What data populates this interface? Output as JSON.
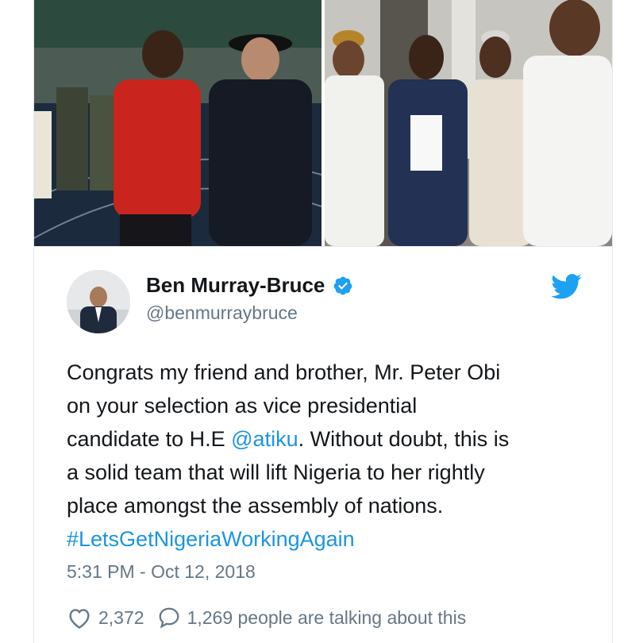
{
  "tweet": {
    "author": {
      "name": "Ben Murray-Bruce",
      "handle": "@benmurraybruce",
      "verified": true
    },
    "text_lines": [
      {
        "parts": [
          {
            "text": "Congrats my friend and brother, Mr. Peter Obi",
            "type": "plain"
          }
        ]
      },
      {
        "parts": [
          {
            "text": "on your selection as vice presidential",
            "type": "plain"
          }
        ]
      },
      {
        "parts": [
          {
            "text": "candidate to H.E ",
            "type": "plain"
          },
          {
            "text": "@atiku",
            "type": "mention"
          },
          {
            "text": ". Without doubt, this is",
            "type": "plain"
          }
        ]
      },
      {
        "parts": [
          {
            "text": "a solid team that will lift Nigeria to her rightly",
            "type": "plain"
          }
        ]
      },
      {
        "parts": [
          {
            "text": "place amongst the assembly of nations.",
            "type": "plain"
          }
        ]
      },
      {
        "parts": [
          {
            "text": "#LetsGetNigeriaWorkingAgain",
            "type": "hashtag"
          }
        ]
      }
    ],
    "timestamp": "5:31 PM - Oct 12, 2018",
    "likes": "2,372",
    "talking": "1,269 people are talking about this"
  },
  "icons": {
    "brand": "twitter-bird-icon",
    "verified": "verified-badge-icon",
    "like": "heart-icon",
    "reply": "comment-icon"
  },
  "colors": {
    "brand": "#1da1f2",
    "link": "#1b95e0",
    "text": "#14171a",
    "muted": "#657786",
    "border": "#e1e8ed"
  }
}
